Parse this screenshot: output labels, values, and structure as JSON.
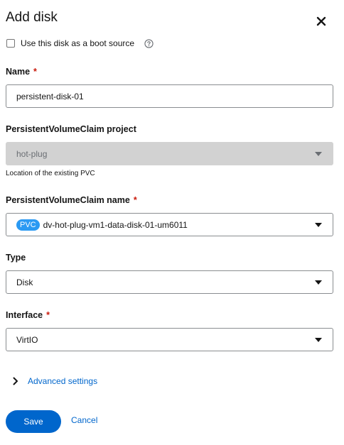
{
  "dialog": {
    "title": "Add disk",
    "close_icon": "close-icon"
  },
  "boot_source": {
    "label": "Use this disk as a boot source",
    "checked": false,
    "help_icon": "question-circle-icon"
  },
  "name": {
    "label": "Name",
    "required": "*",
    "value": "persistent-disk-01"
  },
  "pvc_project": {
    "label": "PersistentVolumeClaim project",
    "value": "hot-plug",
    "helper": "Location of the existing PVC",
    "disabled": true
  },
  "pvc_name": {
    "label": "PersistentVolumeClaim name",
    "required": "*",
    "badge": "PVC",
    "value": "dv-hot-plug-vm1-data-disk-01-um6011"
  },
  "type": {
    "label": "Type",
    "value": "Disk"
  },
  "interface": {
    "label": "Interface",
    "required": "*",
    "value": "VirtIO"
  },
  "advanced": {
    "label": "Advanced settings",
    "expanded": false
  },
  "actions": {
    "save": "Save",
    "cancel": "Cancel"
  },
  "colors": {
    "primary": "#0066cc",
    "required": "#c9190b",
    "badge": "#2b9af3",
    "disabled_field": "#d2d2d2"
  }
}
